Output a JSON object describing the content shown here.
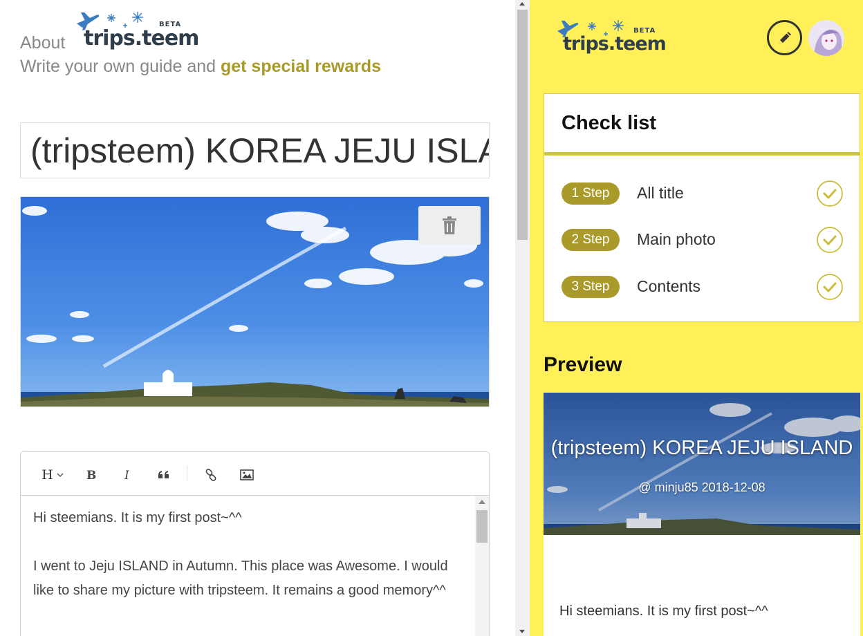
{
  "brand": {
    "name": "trips.teem",
    "badge": "BETA"
  },
  "header": {
    "about_label": "About",
    "tagline_prefix": "Write your own guide and ",
    "tagline_highlight": "get special rewards"
  },
  "post": {
    "title": "(tripsteem) KOREA JEJU ISLAND",
    "author": "@ minju85",
    "date": "2018-12-08",
    "body": [
      "Hi steemians. It is my first post~^^",
      "I went to Jeju ISLAND in Autumn. This place was Awesome. I would like to share my picture with tripsteem. It remains a good memory^^"
    ]
  },
  "editor_toolbar": {
    "heading_label": "H",
    "buttons": [
      "heading",
      "bold",
      "italic",
      "quote",
      "link",
      "image"
    ]
  },
  "checklist": {
    "title": "Check list",
    "steps": [
      {
        "badge": "1 Step",
        "label": "All title",
        "done": true
      },
      {
        "badge": "2 Step",
        "label": "Main photo",
        "done": true
      },
      {
        "badge": "3 Step",
        "label": "Contents",
        "done": true
      }
    ]
  },
  "preview": {
    "heading": "Preview",
    "meta": "@ minju85 2018-12-08",
    "first_line": "Hi steemians. It is my first post~^^"
  },
  "colors": {
    "accent": "#a99a2a",
    "panel_bg": "#fff05a",
    "check_border": "#d7cf4c",
    "logo_dark": "#2f3e4a",
    "logo_blue": "#3b7bbf"
  },
  "icons": [
    "trash-icon",
    "pencil-icon",
    "check-icon",
    "bold-icon",
    "italic-icon",
    "quote-icon",
    "link-icon",
    "image-icon",
    "airplane-icon",
    "snowflake-icon"
  ]
}
